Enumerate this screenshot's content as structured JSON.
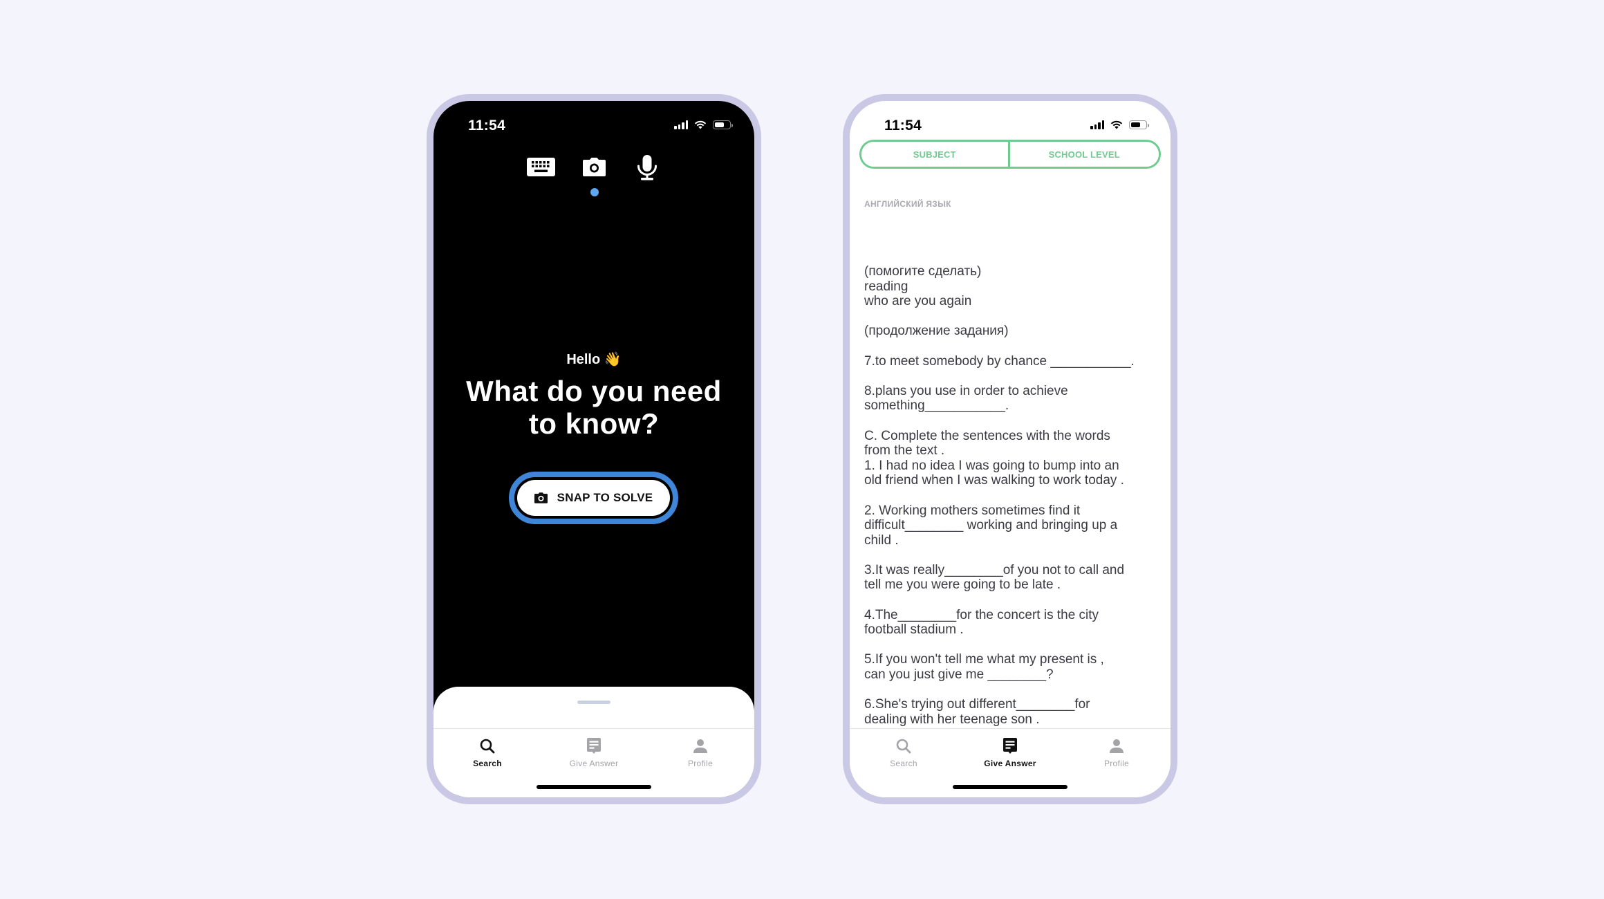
{
  "colors": {
    "page_background": "#F4F4FD",
    "device_frame": "#C9C9E6",
    "accent_blue": "#3F86D9",
    "mode_indicator": "#5BA8F0",
    "accent_green": "#6FCB8F",
    "tab_active": "#111111",
    "tab_inactive": "#A3A3A8"
  },
  "left_screen": {
    "status_bar": {
      "time": "11:54"
    },
    "input_modes": [
      {
        "name": "keyboard",
        "icon": "keyboard-icon"
      },
      {
        "name": "camera",
        "icon": "camera-icon",
        "selected": true
      },
      {
        "name": "microphone",
        "icon": "microphone-icon"
      }
    ],
    "greeting": "Hello 👋",
    "headline_line1": "What do you need",
    "headline_line2": "to know?",
    "snap_button": {
      "label": "SNAP TO SOLVE",
      "icon": "camera-icon"
    },
    "tabbar": {
      "items": [
        {
          "label": "Search",
          "icon": "search-icon",
          "active": true
        },
        {
          "label": "Give Answer",
          "icon": "answer-icon",
          "active": false
        },
        {
          "label": "Profile",
          "icon": "profile-icon",
          "active": false
        }
      ]
    }
  },
  "right_screen": {
    "status_bar": {
      "time": "11:54"
    },
    "filters": [
      {
        "label": "SUBJECT"
      },
      {
        "label": "SCHOOL LEVEL"
      }
    ],
    "subject_label": "АНГЛИЙСКИЙ ЯЗЫК",
    "question_text": "(помогите сделать)\nreading\nwho are you again\n\n(продолжение задания)\n\n7.to meet somebody by chance ___________.\n\n8.plans you use in order to achieve\nsomething___________.\n\nC. Complete the sentences with the words\nfrom the text .\n1. I had no idea I was going to bump into an\nold friend when I was walking to work today .\n\n2. Working mothers sometimes find it\ndifficult________ working and bringing up a\nchild .\n\n3.It was really________of you not to call and\ntell me you were going to be late .\n\n4.The________for the concert is the city\nfootball stadium .\n\n5.If you won't tell me what my present is ,\ncan you just give me ________?\n\n6.She's trying out different________for\ndealing with her teenage son .",
    "tabbar": {
      "items": [
        {
          "label": "Search",
          "icon": "search-icon",
          "active": false
        },
        {
          "label": "Give Answer",
          "icon": "answer-icon",
          "active": true
        },
        {
          "label": "Profile",
          "icon": "profile-icon",
          "active": false
        }
      ]
    }
  }
}
